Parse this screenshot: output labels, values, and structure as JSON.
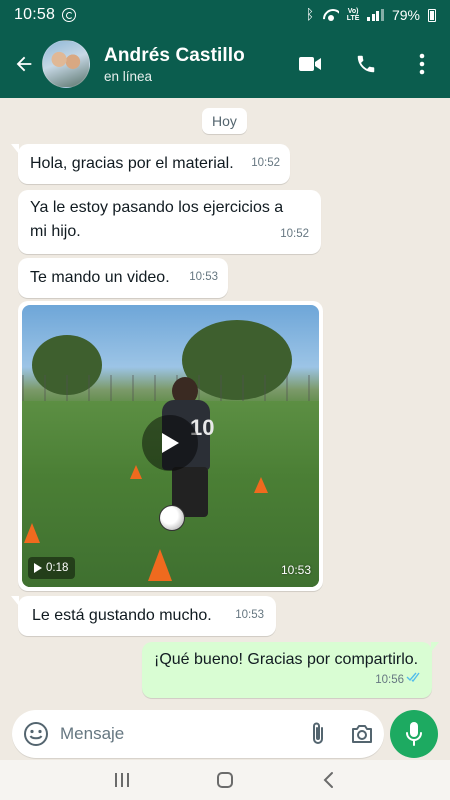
{
  "status_bar": {
    "time": "10:58",
    "network_label": "LTE",
    "battery": "79%"
  },
  "header": {
    "contact_name": "Andrés Castillo",
    "contact_status": "en línea",
    "back_icon": "arrow-left-icon",
    "video_call_icon": "video-camera-icon",
    "voice_call_icon": "phone-icon",
    "menu_icon": "more-vertical-icon",
    "color": "#0b5d4e"
  },
  "chat": {
    "day_label": "Hoy",
    "background": "#efeae2",
    "messages": [
      {
        "direction": "in",
        "type": "text",
        "text": "Hola, gracias por el material.",
        "time": "10:52"
      },
      {
        "direction": "in",
        "type": "text",
        "text": "Ya le estoy pasando los ejercicios a mi hijo.",
        "time": "10:52"
      },
      {
        "direction": "in",
        "type": "text",
        "text": "Te mando un video.",
        "time": "10:53"
      },
      {
        "direction": "in",
        "type": "video",
        "duration": "0:18",
        "time": "10:53",
        "jersey_number": "10"
      },
      {
        "direction": "in",
        "type": "text",
        "text": "Le está gustando mucho.",
        "time": "10:53"
      },
      {
        "direction": "out",
        "type": "text",
        "text": "¡Qué bueno! Gracias por compartirlo.",
        "time": "10:56",
        "read": true
      }
    ],
    "outgoing_bubble_color": "#d9fdd3",
    "read_tick_color": "#53bdeb"
  },
  "composer": {
    "placeholder": "Mensaje",
    "emoji_icon": "emoji-icon",
    "attach_icon": "paperclip-icon",
    "camera_icon": "camera-icon",
    "mic_icon": "microphone-icon",
    "mic_color": "#1daa61"
  },
  "nav_bar": {
    "recents_icon": "recents-icon",
    "home_icon": "home-icon",
    "back_icon": "nav-back-icon"
  }
}
